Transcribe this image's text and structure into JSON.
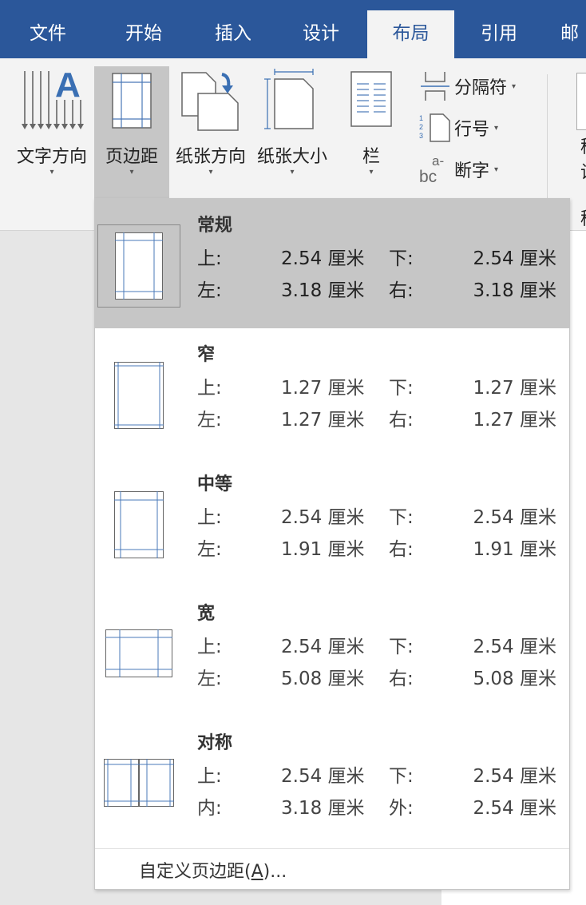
{
  "tabs": [
    {
      "label": "文件",
      "active": false
    },
    {
      "label": "开始",
      "active": false
    },
    {
      "label": "插入",
      "active": false
    },
    {
      "label": "设计",
      "active": false
    },
    {
      "label": "布局",
      "active": true
    },
    {
      "label": "引用",
      "active": false
    },
    {
      "label": "邮",
      "active": false
    }
  ],
  "ribbon": {
    "text_direction": "文字方向",
    "margins": "页边距",
    "orientation": "纸张方向",
    "size": "纸张大小",
    "columns": "栏",
    "breaks": "分隔符",
    "line_numbers": "行号",
    "hyphenation": "断字",
    "cut_text_1": "稿",
    "cut_text_2": "设",
    "cut_group": "稿",
    "dropdown_arrow": "▾"
  },
  "margins_menu": {
    "presets": [
      {
        "name": "常规",
        "selected": true,
        "r1": {
          "k1": "上:",
          "v1": "2.54 厘米",
          "k2": "下:",
          "v2": "2.54 厘米"
        },
        "r2": {
          "k1": "左:",
          "v1": "3.18 厘米",
          "k2": "右:",
          "v2": "3.18 厘米"
        }
      },
      {
        "name": "窄",
        "selected": false,
        "r1": {
          "k1": "上:",
          "v1": "1.27 厘米",
          "k2": "下:",
          "v2": "1.27 厘米"
        },
        "r2": {
          "k1": "左:",
          "v1": "1.27 厘米",
          "k2": "右:",
          "v2": "1.27 厘米"
        }
      },
      {
        "name": "中等",
        "selected": false,
        "r1": {
          "k1": "上:",
          "v1": "2.54 厘米",
          "k2": "下:",
          "v2": "2.54 厘米"
        },
        "r2": {
          "k1": "左:",
          "v1": "1.91 厘米",
          "k2": "右:",
          "v2": "1.91 厘米"
        }
      },
      {
        "name": "宽",
        "selected": false,
        "r1": {
          "k1": "上:",
          "v1": "2.54 厘米",
          "k2": "下:",
          "v2": "2.54 厘米"
        },
        "r2": {
          "k1": "左:",
          "v1": "5.08 厘米",
          "k2": "右:",
          "v2": "5.08 厘米"
        }
      },
      {
        "name": "对称",
        "selected": false,
        "r1": {
          "k1": "上:",
          "v1": "2.54 厘米",
          "k2": "下:",
          "v2": "2.54 厘米"
        },
        "r2": {
          "k1": "内:",
          "v1": "3.18 厘米",
          "k2": "外:",
          "v2": "2.54 厘米"
        }
      }
    ],
    "custom_prefix": "自定义页边距(",
    "custom_key": "A",
    "custom_suffix": ")..."
  },
  "colors": {
    "accent": "#2b579a",
    "guide": "#4a78b8",
    "selected_bg": "#c6c6c6"
  }
}
